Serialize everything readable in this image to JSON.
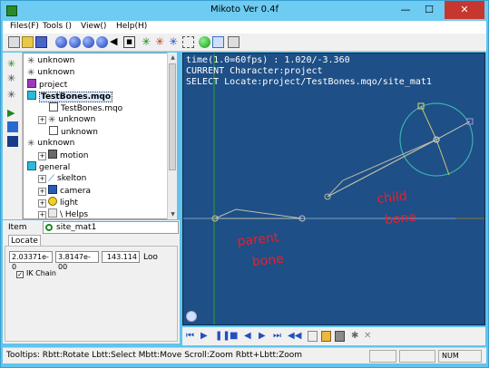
{
  "window": {
    "title": "Mikoto Ver 0.4f",
    "buttons": {
      "minimize": "—",
      "maximize": "☐",
      "close": "✕"
    }
  },
  "menu": [
    "Files(F)",
    "Tools ()",
    "View()",
    "Help(H)"
  ],
  "toolbar": {
    "icons": [
      "new-icon",
      "open-icon",
      "save-icon",
      "render-ball-icon",
      "render-ball-icon",
      "render-ball-icon",
      "render-ball-icon",
      "sound-icon",
      "stop-icon",
      "bone-icon",
      "bone-icon",
      "bone-icon",
      "grid-icon",
      "green-ball-icon",
      "select-icon",
      "panel-icon"
    ]
  },
  "tree": {
    "items": [
      {
        "label": "unknown",
        "icon": "bone-icon",
        "depth": 0
      },
      {
        "label": "unknown",
        "icon": "bone-icon",
        "depth": 0
      },
      {
        "label": "project",
        "icon": "project-icon",
        "depth": 0
      },
      {
        "label": "TestBones.mqo",
        "icon": "cube-icon",
        "depth": 0,
        "selected": true
      },
      {
        "label": "TestBones.mqo",
        "icon": "file-icon",
        "depth": 2
      },
      {
        "label": "unknown",
        "icon": "bone-icon",
        "depth": 1
      },
      {
        "label": "unknown",
        "icon": "file-icon",
        "depth": 2
      },
      {
        "label": "unknown",
        "icon": "bone-icon",
        "depth": 0
      },
      {
        "label": "motion",
        "icon": "motion-icon",
        "depth": 1
      },
      {
        "label": "general",
        "icon": "cube-icon",
        "depth": 0
      },
      {
        "label": "skelton",
        "icon": "skeleton-icon",
        "depth": 1
      },
      {
        "label": "camera",
        "icon": "camera-icon",
        "depth": 1
      },
      {
        "label": "light",
        "icon": "light-icon",
        "depth": 1
      },
      {
        "label": "\\ Helps",
        "icon": "help-icon",
        "depth": 1
      }
    ]
  },
  "item": {
    "label": "Item",
    "value": "site_mat1"
  },
  "locate": {
    "tab": "Locate",
    "x": "2.03371e-0",
    "y": "3.8147e-00",
    "z": "143.114",
    "button": "Loo",
    "ik_chain": "IK Chain"
  },
  "viewport": {
    "line1": "time(1.0=60fps) : 1.020/-3.360",
    "line2": "CURRENT Character:project",
    "line3": "SELECT Locate:project/TestBones.mqo/site_mat1",
    "annotation_child": "child bone",
    "annotation_parent": "parent bone"
  },
  "status": {
    "tooltips": "Tooltips: Rbtt:Rotate  Lbtt:Select  Mbtt:Move  Scroll:Zoom  Rbtt+Lbtt:Zoom",
    "num": "NUM"
  }
}
